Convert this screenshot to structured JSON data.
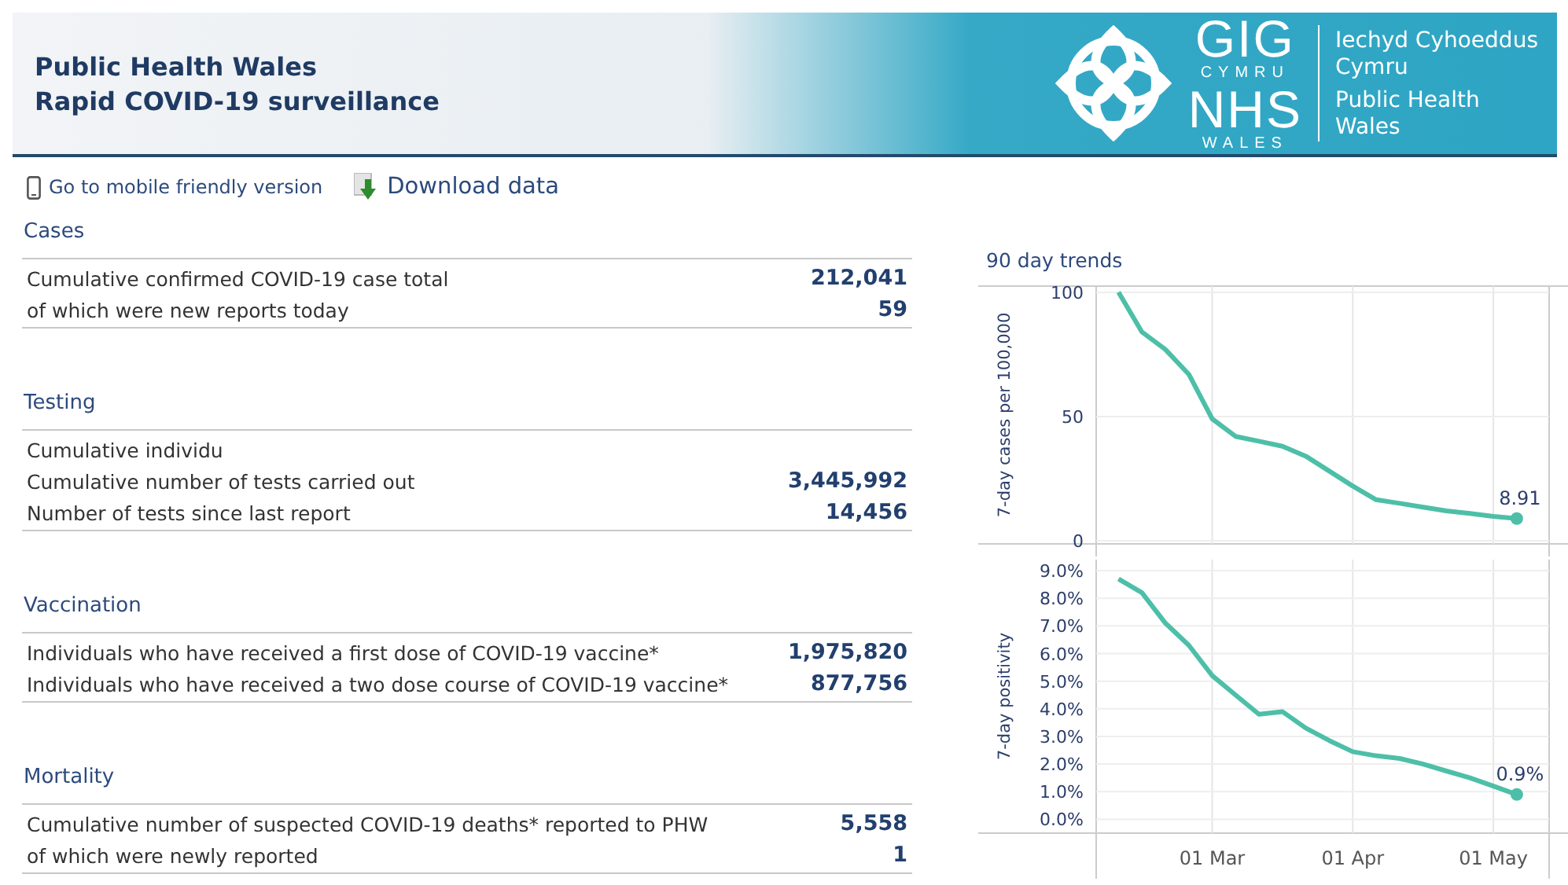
{
  "header": {
    "title_lines": [
      "Public Health Wales",
      "Rapid COVID-19 surveillance"
    ],
    "logo": {
      "gig": "GIG",
      "cymru": "CYMRU",
      "nhs": "NHS",
      "wales": "WALES",
      "lines": [
        "Iechyd Cyhoeddus",
        "Cymru",
        "Public Health",
        "Wales"
      ]
    }
  },
  "links": [
    {
      "kind": "phone",
      "label": "Go to mobile friendly version"
    },
    {
      "kind": "download",
      "label": "Download data"
    }
  ],
  "sections": [
    {
      "title": "Cases",
      "rows": [
        {
          "label": "Cumulative confirmed COVID-19 case total",
          "value": "212,041"
        },
        {
          "label": "of which were new reports today",
          "value": "59"
        }
      ]
    },
    {
      "title": "Testing",
      "rows": [
        {
          "label": "Cumulative individu",
          "value": ""
        },
        {
          "label": "Cumulative number of tests carried out",
          "value": "3,445,992"
        },
        {
          "label": "Number of tests since last report",
          "value": "14,456"
        }
      ]
    },
    {
      "title": "Vaccination",
      "rows": [
        {
          "label": "Individuals who have received a first dose of COVID-19 vaccine*",
          "value": "1,975,820"
        },
        {
          "label": "Individuals who have received a two dose course of COVID-19 vaccine*",
          "value": "877,756"
        }
      ]
    },
    {
      "title": "Mortality",
      "rows": [
        {
          "label": "Cumulative number of suspected COVID-19 deaths* reported to PHW",
          "value": "5,558"
        },
        {
          "label": "of which were newly reported",
          "value": "1"
        }
      ]
    }
  ],
  "trends": {
    "title": "90 day trends",
    "charts": [
      {
        "chart_data": {
          "type": "line",
          "ylabel": "7-day cases per 100,000",
          "categories": [
            null,
            null,
            null,
            null,
            null,
            null,
            null,
            null,
            null,
            null,
            null,
            null,
            null,
            null,
            null,
            null,
            null,
            null
          ],
          "ylim": [
            -1.3,
            102.5
          ],
          "yticks": [
            0,
            50,
            100
          ],
          "grid": true,
          "series": [
            {
              "color": "#4dbfa8",
              "values": [
                100,
                84,
                77,
                67,
                49,
                42,
                40,
                38,
                34,
                28,
                22,
                16.5,
                15,
                13.5,
                12,
                11,
                9.8,
                8.9
              ]
            }
          ],
          "annotations": [
            {
              "y": 8.9,
              "text": "8.91"
            }
          ]
        }
      },
      {
        "chart_data": {
          "type": "line",
          "ylabel": "7-day positivity",
          "categories": [
            null,
            null,
            null,
            null,
            "01 Mar",
            null,
            null,
            null,
            null,
            null,
            "01 Apr",
            null,
            null,
            null,
            null,
            null,
            "01 May",
            null
          ],
          "ylim": [
            -0.5,
            9.4
          ],
          "grid": true,
          "yticks": [
            {
              "value": 0,
              "label": "0.0%"
            },
            {
              "value": 1,
              "label": "1.0%"
            },
            {
              "value": 2,
              "label": "2.0%"
            },
            {
              "value": 3,
              "label": "3.0%"
            },
            {
              "value": 4,
              "label": "4.0%"
            },
            {
              "value": 5,
              "label": "5.0%"
            },
            {
              "value": 6,
              "label": "6.0%"
            },
            {
              "value": 7,
              "label": "7.0%"
            },
            {
              "value": 8,
              "label": "8.0%"
            },
            {
              "value": 9,
              "label": "9.0%"
            }
          ],
          "series": [
            {
              "color": "#4dbfa8",
              "values": [
                8.7,
                8.2,
                7.1,
                6.3,
                5.2,
                4.5,
                3.8,
                3.9,
                3.3,
                2.85,
                2.45,
                2.3,
                2.2,
                2.0,
                1.75,
                1.5,
                1.2,
                0.9
              ]
            }
          ],
          "annotations": [
            {
              "y": 0.9,
              "text": "0.9%"
            }
          ]
        }
      }
    ]
  }
}
